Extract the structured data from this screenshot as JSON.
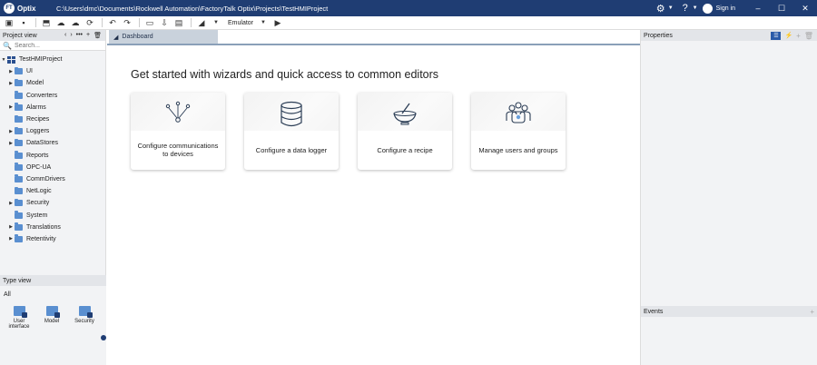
{
  "app": {
    "logo_letters": "FT",
    "name": "Optix",
    "path": "C:\\Users\\dmc\\Documents\\Rockwell Automation\\FactoryTalk Optix\\Projects\\TestHMIProject",
    "signin_label": "Sign in",
    "minimize": "–",
    "maximize": "☐",
    "close": "✕"
  },
  "toolbar": {
    "emulator_label": "Emulator"
  },
  "project_view": {
    "title": "Project view",
    "search_placeholder": "Search...",
    "root": "TestHMIProject",
    "items": [
      {
        "label": "UI",
        "expandable": true
      },
      {
        "label": "Model",
        "expandable": true
      },
      {
        "label": "Converters",
        "expandable": false
      },
      {
        "label": "Alarms",
        "expandable": true
      },
      {
        "label": "Recipes",
        "expandable": false
      },
      {
        "label": "Loggers",
        "expandable": true
      },
      {
        "label": "DataStores",
        "expandable": true
      },
      {
        "label": "Reports",
        "expandable": false
      },
      {
        "label": "OPC-UA",
        "expandable": false
      },
      {
        "label": "CommDrivers",
        "expandable": false
      },
      {
        "label": "NetLogic",
        "expandable": false
      },
      {
        "label": "Security",
        "expandable": true
      },
      {
        "label": "System",
        "expandable": false
      },
      {
        "label": "Translations",
        "expandable": true
      },
      {
        "label": "Retentivity",
        "expandable": true
      }
    ]
  },
  "type_view": {
    "title": "Type view",
    "filter": "All",
    "items": [
      {
        "label": "User interface"
      },
      {
        "label": "Model"
      },
      {
        "label": "Security"
      }
    ]
  },
  "main": {
    "tab_label": "Dashboard",
    "headline": "Get started with wizards and quick access to common editors",
    "cards": [
      {
        "label": "Configure communications to devices",
        "icon": "network-icon"
      },
      {
        "label": "Configure a data logger",
        "icon": "database-icon"
      },
      {
        "label": "Configure a recipe",
        "icon": "recipe-bowl-icon"
      },
      {
        "label": "Manage users and groups",
        "icon": "users-icon"
      }
    ]
  },
  "properties": {
    "title": "Properties"
  },
  "events": {
    "title": "Events"
  },
  "colors": {
    "titlebar": "#1f3d73",
    "accent": "#2a5aa8",
    "folder": "#5a8fd0"
  }
}
